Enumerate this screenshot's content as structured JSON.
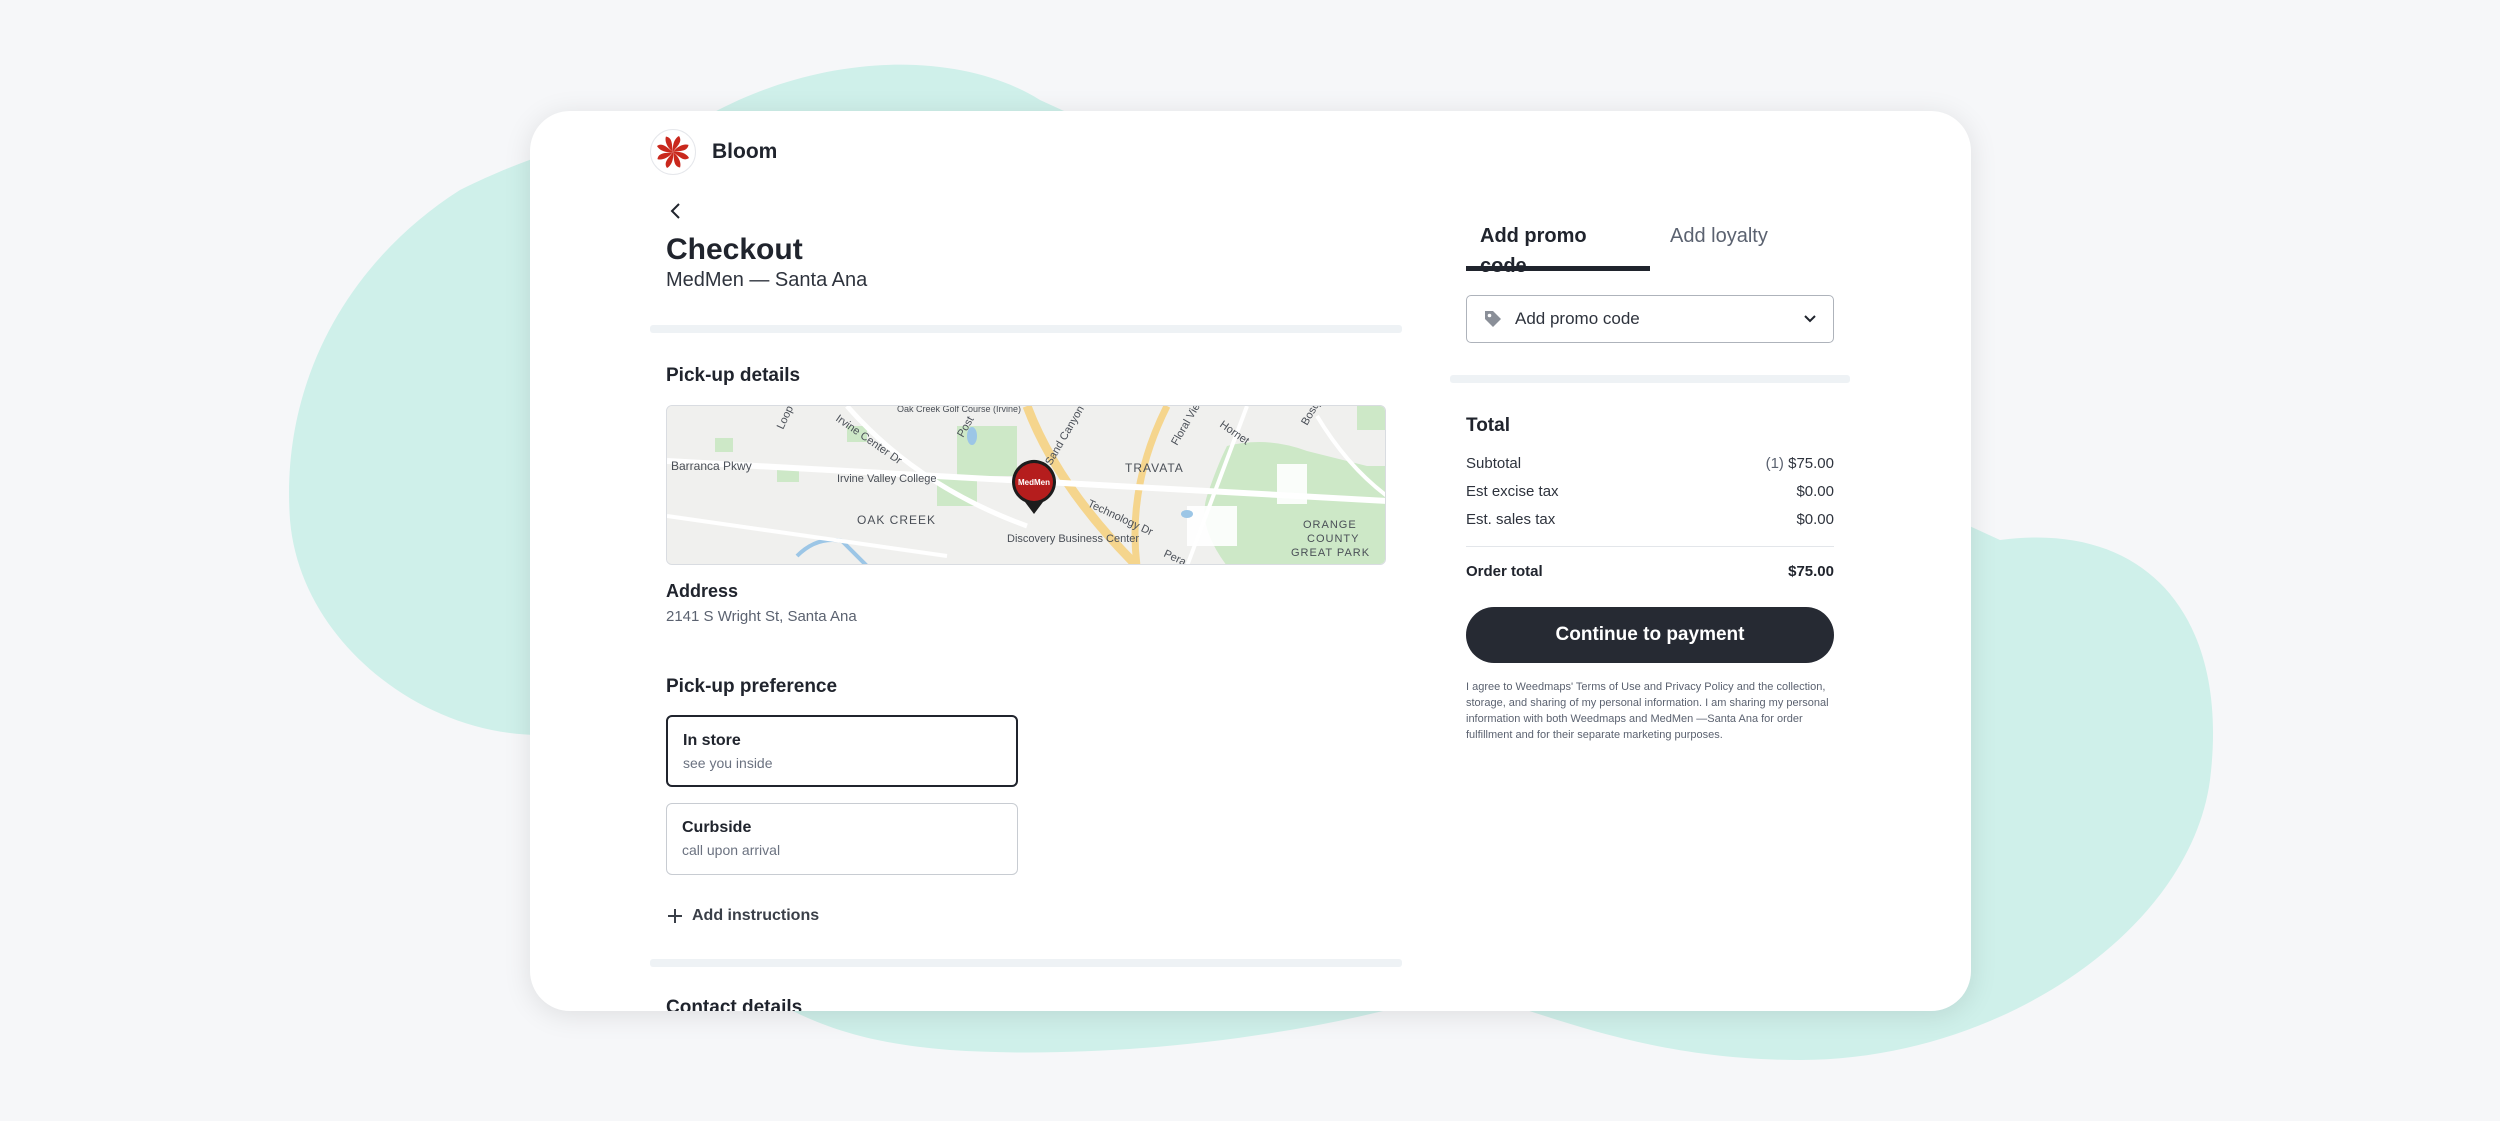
{
  "brand": {
    "name": "Bloom"
  },
  "header": {
    "title": "Checkout",
    "store": "MedMen — Santa Ana"
  },
  "pickup": {
    "section_title": "Pick-up details",
    "map": {
      "labels": [
        "Barranca Pkwy",
        "Irvine Valley College",
        "OAK CREEK",
        "Discovery Business Center",
        "TRAVATA",
        "Technology Dr",
        "ORANGE",
        "COUNTY",
        "GREAT PARK",
        "Irvine Center Dr",
        "Oak Creek Golf Course (Irvine)",
        "Post",
        "Sand Canyon Ave",
        "Floral View",
        "Hornet",
        "Bosque",
        "Loop",
        "Pera",
        "MedMen"
      ]
    },
    "address_label": "Address",
    "address_value": "2141 S Wright St, Santa Ana"
  },
  "preference": {
    "section_title": "Pick-up preference",
    "options": [
      {
        "title": "In store",
        "subtitle": "see you inside",
        "selected": true
      },
      {
        "title": "Curbside",
        "subtitle": "call upon arrival",
        "selected": false
      }
    ],
    "add_instructions": "Add instructions"
  },
  "contact": {
    "section_title": "Contact details"
  },
  "sidebar": {
    "tabs": [
      {
        "label": "Add promo code",
        "active": true
      },
      {
        "label": "Add loyalty",
        "active": false
      }
    ],
    "promo_placeholder": "Add promo code",
    "total_title": "Total",
    "subtotal_label": "Subtotal",
    "subtotal_qty": "(1)",
    "subtotal_value": "$75.00",
    "excise_label": "Est excise tax",
    "excise_value": "$0.00",
    "sales_label": "Est. sales tax",
    "sales_value": "$0.00",
    "order_total_label": "Order total",
    "order_total_value": "$75.00",
    "pay_button": "Continue to payment",
    "legal": "I agree to Weedmaps' Terms of Use and Privacy Policy and the collection, storage, and sharing of my personal information. I am sharing my personal information with both Weedmaps and MedMen —Santa Ana for order fulfillment and for their separate marketing purposes."
  },
  "colors": {
    "background_blob": "#cff0ea",
    "primary_button": "#262a33",
    "brand_red": "#c9281d"
  }
}
